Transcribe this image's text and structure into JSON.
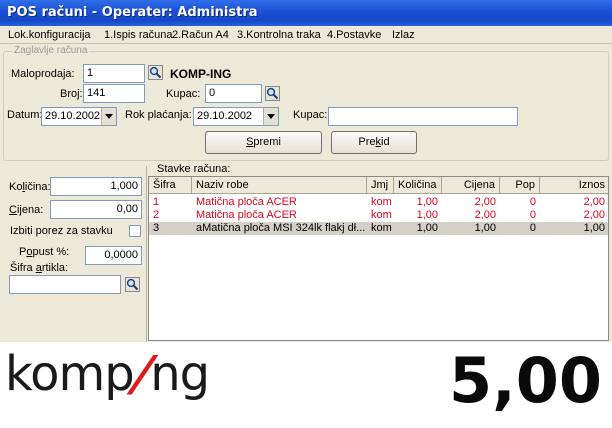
{
  "window": {
    "title": "POS računi - Operater: Administra"
  },
  "menu": [
    "Lok.konfiguracija",
    "1.Ispis računa",
    "2.Račun A4",
    "3.Kontrolna traka",
    "4.Postavke",
    "Izlaz"
  ],
  "header": {
    "legend": "Zaglavlje računa",
    "maloprodaja_label": "Maloprodaja:",
    "maloprodaja_value": "1",
    "company_name": "KOMP-ING",
    "broj_label": "Broj:",
    "broj_value": "141",
    "kupac_label": "Kupac:",
    "kupac_value": "0",
    "datum_label": "Datum:",
    "datum_value": "29.10.2002",
    "rok_label": "Rok plaćanja:",
    "rok_value": "29.10.2002",
    "kupac2_label": "Kupac:",
    "kupac2_value": "",
    "spremi_pre": "",
    "spremi_key": "S",
    "spremi_post": "premi",
    "prekid_pre": "Pre",
    "prekid_key": "k",
    "prekid_post": "id"
  },
  "left": {
    "kolicina_pre": "Ko",
    "kolicina_key": "l",
    "kolicina_post": "ičina:",
    "kolicina_value": "1,000",
    "cijena_pre": "",
    "cijena_key": "C",
    "cijena_post": "ijena:",
    "cijena_value": "0,00",
    "izbiti_label": "Izbiti porez za stavku",
    "popust_pre": "P",
    "popust_key": "o",
    "popust_post": "pust %:",
    "popust_value": "0,0000",
    "sifra_pre": "Šifra ",
    "sifra_key": "a",
    "sifra_post": "rtikla:",
    "sifra_value": ""
  },
  "table": {
    "title": "Stavke računa:",
    "columns": [
      "Šifra",
      "Naziv robe",
      "Jmj",
      "Količina",
      "Cijena",
      "Pop",
      "Iznos"
    ],
    "rows": [
      {
        "sifra": "1",
        "naziv": "Matična ploča ACER",
        "jmj": "kom",
        "kolicina": "1,00",
        "cijena": "2,00",
        "pop": "0",
        "iznos": "2,00",
        "color": "#e8001c"
      },
      {
        "sifra": "2",
        "naziv": "Matična ploča ACER",
        "jmj": "kom",
        "kolicina": "1,00",
        "cijena": "2,00",
        "pop": "0",
        "iznos": "2,00",
        "color": "#e8001c"
      },
      {
        "sifra": "3",
        "naziv": "aMatična ploča MSI 324lk flakj dł...",
        "jmj": "kom",
        "kolicina": "1,00",
        "cijena": "1,00",
        "pop": "0",
        "iznos": "1,00",
        "color": "#000000"
      }
    ]
  },
  "footer": {
    "logo_left": "komp",
    "logo_slash": "/",
    "logo_right": "ng",
    "total": "5,00"
  },
  "colors": {
    "titlebar": "#1a4fd6",
    "accent_red": "#e21a1a",
    "row_red": "#e8001c",
    "selected_row": "#d4d0c8"
  }
}
